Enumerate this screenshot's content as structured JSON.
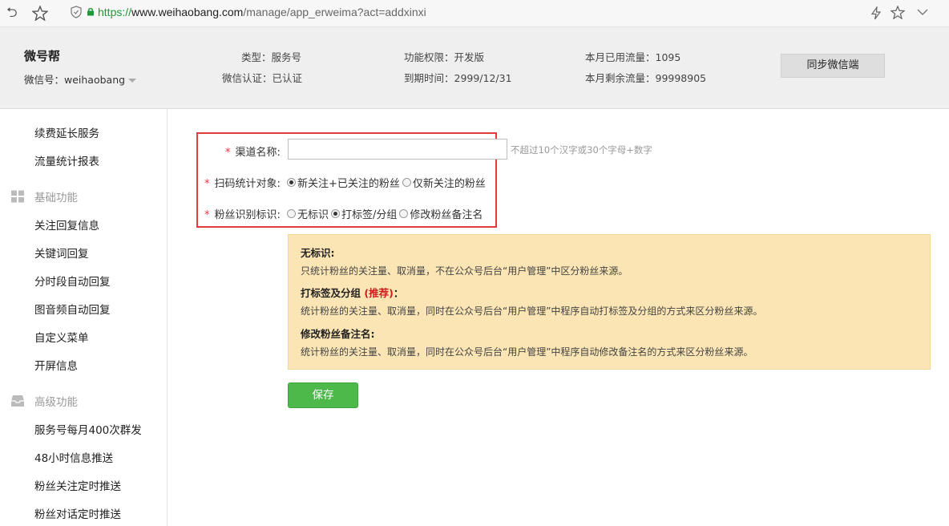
{
  "browser": {
    "url_scheme": "https://",
    "url_host": "www.weihaobang.com",
    "url_path": "/manage/app_erweima?act=addxinxi"
  },
  "header": {
    "account_name": "微号帮",
    "wechat_id": "微信号：weihaobang",
    "type": "类型：服务号",
    "verified": "微信认证：已认证",
    "permission": "功能权限：开发版",
    "expire": "到期时间：2999/12/31",
    "used_traffic": "本月已用流量：1095",
    "remaining_traffic": "本月剩余流量：99998905",
    "sync_button": "同步微信端"
  },
  "sidebar": {
    "top_items": [
      "续费延长服务",
      "流量统计报表"
    ],
    "basic_section": "基础功能",
    "basic_items": [
      "关注回复信息",
      "关键词回复",
      "分时段自动回复",
      "图音频自动回复",
      "自定义菜单",
      "开屏信息"
    ],
    "advanced_section": "高级功能",
    "advanced_items": [
      "服务号每月400次群发",
      "48小时信息推送",
      "粉丝关注定时推送",
      "粉丝对话定时推送"
    ]
  },
  "form": {
    "channel_label": "渠道名称:",
    "channel_value": "",
    "channel_hint": "不超过10个汉字或30个字母+数字",
    "scan_label": "扫码统计对象:",
    "scan_options": [
      {
        "label": "新关注+已关注的粉丝",
        "checked": true
      },
      {
        "label": "仅新关注的粉丝",
        "checked": false
      }
    ],
    "fan_label": "粉丝识别标识:",
    "fan_options": [
      {
        "label": "无标识",
        "checked": false
      },
      {
        "label": "打标签/分组",
        "checked": true
      },
      {
        "label": "修改粉丝备注名",
        "checked": false
      }
    ],
    "required_mark": "*"
  },
  "notes": {
    "h1": "无标识:",
    "p1": "只统计粉丝的关注量、取消量，不在公众号后台“用户管理”中区分粉丝来源。",
    "h2": "打标签及分组",
    "h2_recommend": "(推荐)",
    "h2_colon": "：",
    "p2": "统计粉丝的关注量、取消量，同时在公众号后台“用户管理”中程序自动打标签及分组的方式来区分粉丝来源。",
    "h3": "修改粉丝备注名:",
    "p3": "统计粉丝的关注量、取消量，同时在公众号后台“用户管理”中程序自动修改备注名的方式来区分粉丝来源。"
  },
  "save_button": "保存"
}
